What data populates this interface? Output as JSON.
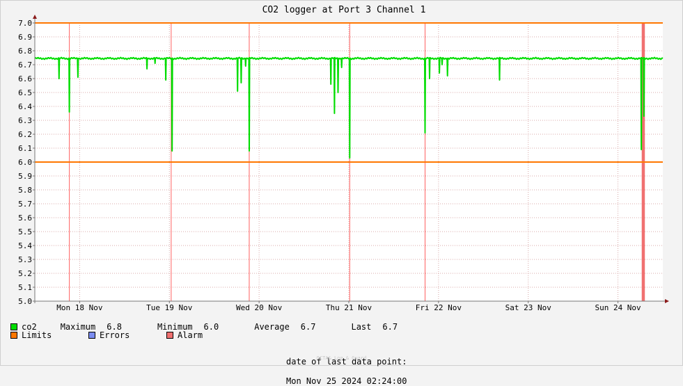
{
  "chart_data": {
    "type": "line",
    "title": "CO2 logger at Port 3 Channel 1",
    "ylim": [
      5.0,
      7.0
    ],
    "y_ticks": [
      "5.0",
      "5.1",
      "5.2",
      "5.3",
      "5.4",
      "5.5",
      "5.6",
      "5.7",
      "5.8",
      "5.9",
      "6.0",
      "6.1",
      "6.2",
      "6.3",
      "6.4",
      "6.5",
      "6.6",
      "6.7",
      "6.8",
      "6.9",
      "7.0"
    ],
    "x_range_days": [
      0,
      7.0
    ],
    "x_tick_labels": [
      {
        "label": "Mon 18 Nov",
        "at": 0.5
      },
      {
        "label": "Tue 19 Nov",
        "at": 1.5
      },
      {
        "label": "Wed 20 Nov",
        "at": 2.5
      },
      {
        "label": "Thu 21 Nov",
        "at": 3.5
      },
      {
        "label": "Fri 22 Nov",
        "at": 4.5
      },
      {
        "label": "Sat 23 Nov",
        "at": 5.5
      },
      {
        "label": "Sun 24 Nov",
        "at": 6.5
      }
    ],
    "limits": {
      "upper": 7.0,
      "lower": 6.0
    },
    "series": [
      {
        "name": "co2",
        "baseline": 6.745,
        "dips": [
          {
            "x": 0.27,
            "y": 6.6
          },
          {
            "x": 0.385,
            "y": 6.36
          },
          {
            "x": 0.48,
            "y": 6.61
          },
          {
            "x": 1.25,
            "y": 6.67
          },
          {
            "x": 1.34,
            "y": 6.71
          },
          {
            "x": 1.46,
            "y": 6.59
          },
          {
            "x": 1.53,
            "y": 6.08
          },
          {
            "x": 2.26,
            "y": 6.51
          },
          {
            "x": 2.3,
            "y": 6.57
          },
          {
            "x": 2.35,
            "y": 6.69
          },
          {
            "x": 2.39,
            "y": 6.08
          },
          {
            "x": 3.3,
            "y": 6.56
          },
          {
            "x": 3.34,
            "y": 6.35
          },
          {
            "x": 3.38,
            "y": 6.5
          },
          {
            "x": 3.42,
            "y": 6.68
          },
          {
            "x": 3.51,
            "y": 6.03
          },
          {
            "x": 4.35,
            "y": 6.21
          },
          {
            "x": 4.4,
            "y": 6.6
          },
          {
            "x": 4.51,
            "y": 6.64
          },
          {
            "x": 4.54,
            "y": 6.7
          },
          {
            "x": 4.6,
            "y": 6.62
          },
          {
            "x": 5.18,
            "y": 6.59
          },
          {
            "x": 6.76,
            "y": 6.09
          },
          {
            "x": 6.79,
            "y": 6.33
          }
        ],
        "max": "6.8",
        "min": "6.0",
        "avg": "6.7",
        "last": "6.7"
      }
    ],
    "alarm_band": {
      "from": 6.765,
      "to": 6.8
    }
  },
  "legend": {
    "co2_label": "co2",
    "maximum_label": "Maximum",
    "maximum_value": "6.8",
    "minimum_label": "Minimum",
    "minimum_value": "6.0",
    "average_label": "Average",
    "average_value": "6.7",
    "last_label": "Last",
    "last_value": "6.7",
    "limits_label": "Limits",
    "errors_label": "Errors",
    "alarm_label": "Alarm"
  },
  "colors": {
    "series": "#00dd00",
    "limits": "#ff7700",
    "errors": "#7b8cf0",
    "alarm": "#f07070",
    "day_line": "#ff6060",
    "grid": "#d8a8a8"
  },
  "footer": {
    "date_label": "date of last data point:",
    "date_value": "Mon Nov 25 2024 02:24:00",
    "watermark": "OCTA& Log & Guard"
  }
}
